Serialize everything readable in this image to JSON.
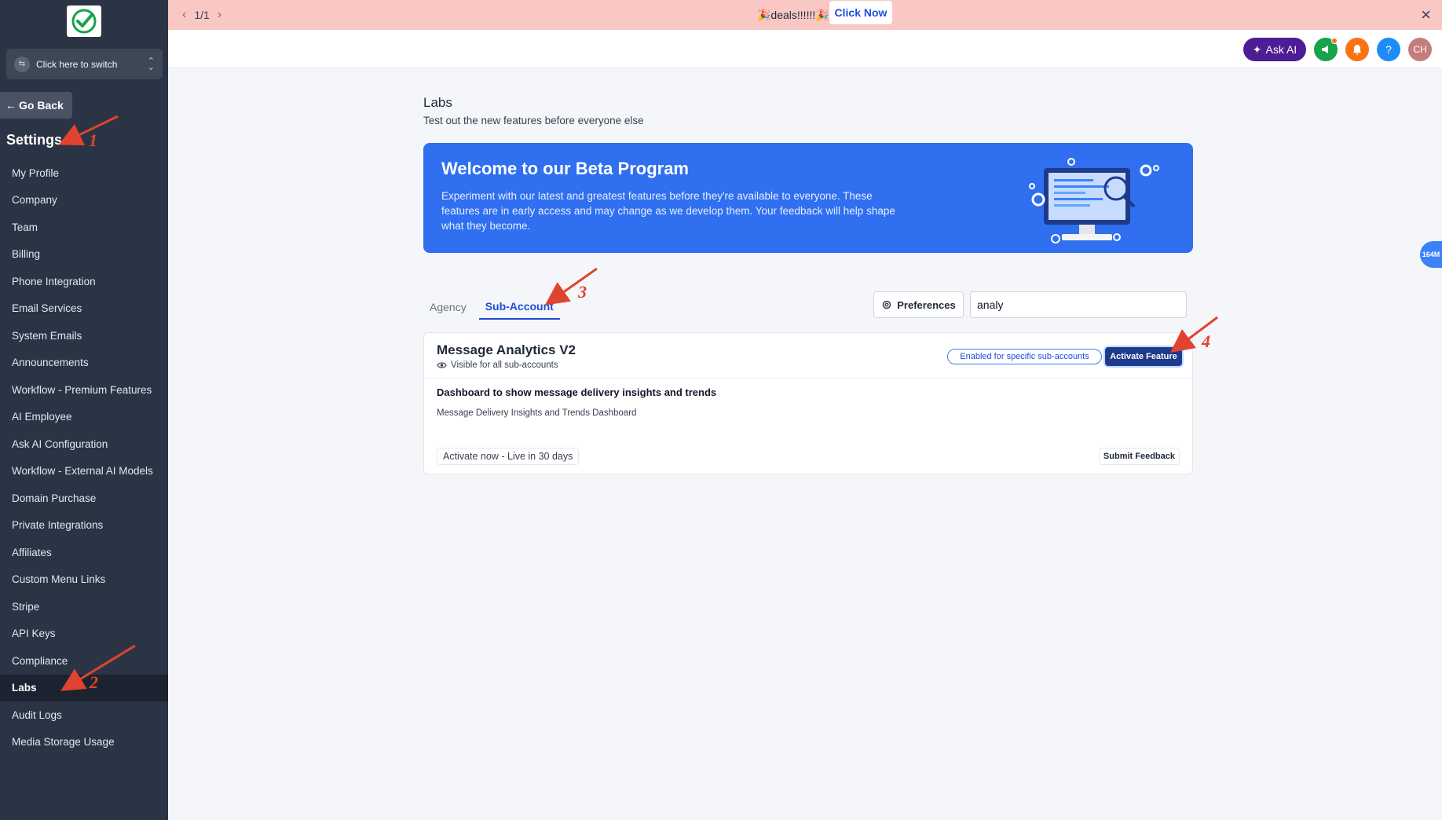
{
  "sidebar": {
    "switcher_label": "Click here to switch",
    "go_back": "Go Back",
    "settings_title": "Settings",
    "items": [
      {
        "label": "My Profile"
      },
      {
        "label": "Company"
      },
      {
        "label": "Team"
      },
      {
        "label": "Billing"
      },
      {
        "label": "Phone Integration"
      },
      {
        "label": "Email Services"
      },
      {
        "label": "System Emails"
      },
      {
        "label": "Announcements"
      },
      {
        "label": "Workflow - Premium Features"
      },
      {
        "label": "AI Employee"
      },
      {
        "label": "Ask AI Configuration"
      },
      {
        "label": "Workflow - External AI Models"
      },
      {
        "label": "Domain Purchase"
      },
      {
        "label": "Private Integrations"
      },
      {
        "label": "Affiliates"
      },
      {
        "label": "Custom Menu Links"
      },
      {
        "label": "Stripe"
      },
      {
        "label": "API Keys"
      },
      {
        "label": "Compliance"
      },
      {
        "label": "Labs"
      },
      {
        "label": "Audit Logs"
      },
      {
        "label": "Media Storage Usage"
      }
    ],
    "active_item": "Labs"
  },
  "announcement": {
    "pager": "1/1",
    "deal_text": "🎉deals!!!!!!🎉",
    "cta": "Click Now"
  },
  "header": {
    "ask_ai": "Ask AI",
    "avatar_initials": "CH",
    "help": "?"
  },
  "main": {
    "title": "Labs",
    "subtitle": "Test out the new features before everyone else",
    "banner": {
      "title": "Welcome to our Beta Program",
      "body": "Experiment with our latest and greatest features before they're available to everyone. These features are in early access and may change as we develop them. Your feedback will help shape what they become."
    },
    "tabs": [
      {
        "label": "Agency"
      },
      {
        "label": "Sub-Account"
      }
    ],
    "preferences": "Preferences",
    "search_value": "analy",
    "feature_card": {
      "title": "Message Analytics V2",
      "visibility": "Visible for all sub-accounts",
      "badge": "Enabled for specific sub-accounts",
      "activate": "Activate Feature",
      "description": "Dashboard to show message delivery insights and trends",
      "detail": "Message Delivery Insights and Trends Dashboard",
      "live_chip": "Activate now - Live in 30 days",
      "feedback": "Submit Feedback"
    },
    "float_pill": "164M"
  },
  "annotations": [
    "1",
    "2",
    "3",
    "4"
  ],
  "colors": {
    "sidebar_bg": "#2b3444",
    "accent": "#1d4ed8",
    "banner_bg": "#2f6ff0",
    "announcement_bg": "#f9c7c4",
    "annotation": "#e0432f"
  }
}
